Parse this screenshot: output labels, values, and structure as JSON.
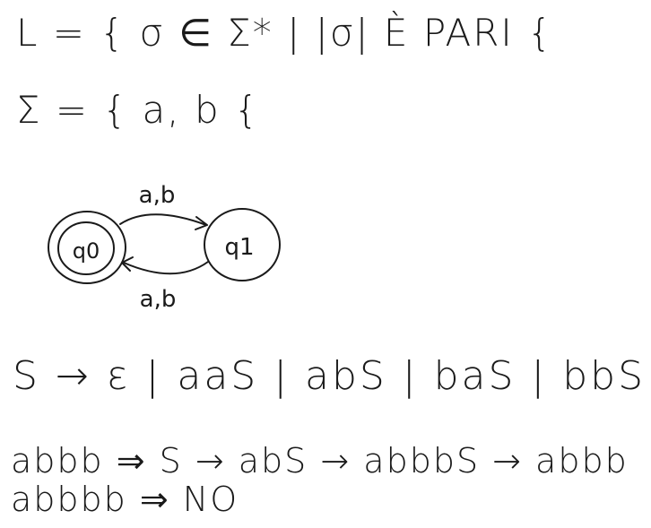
{
  "language_line": "L = { σ ∈ Σ* | |σ| È PARI {",
  "alphabet_line": "Σ = { a, b {",
  "automaton": {
    "states": [
      {
        "label": "q0",
        "accepting": true
      },
      {
        "label": "q1",
        "accepting": false
      }
    ],
    "transitions": [
      {
        "from": "q0",
        "to": "q1",
        "label": "a,b"
      },
      {
        "from": "q1",
        "to": "q0",
        "label": "a,b"
      }
    ]
  },
  "grammar_line": "S → ε | aaS | abS | baS | bbS",
  "derivations": [
    "abbb ⇒ S → abS → abbbS → abbb",
    "abbbb ⇒ NO"
  ]
}
